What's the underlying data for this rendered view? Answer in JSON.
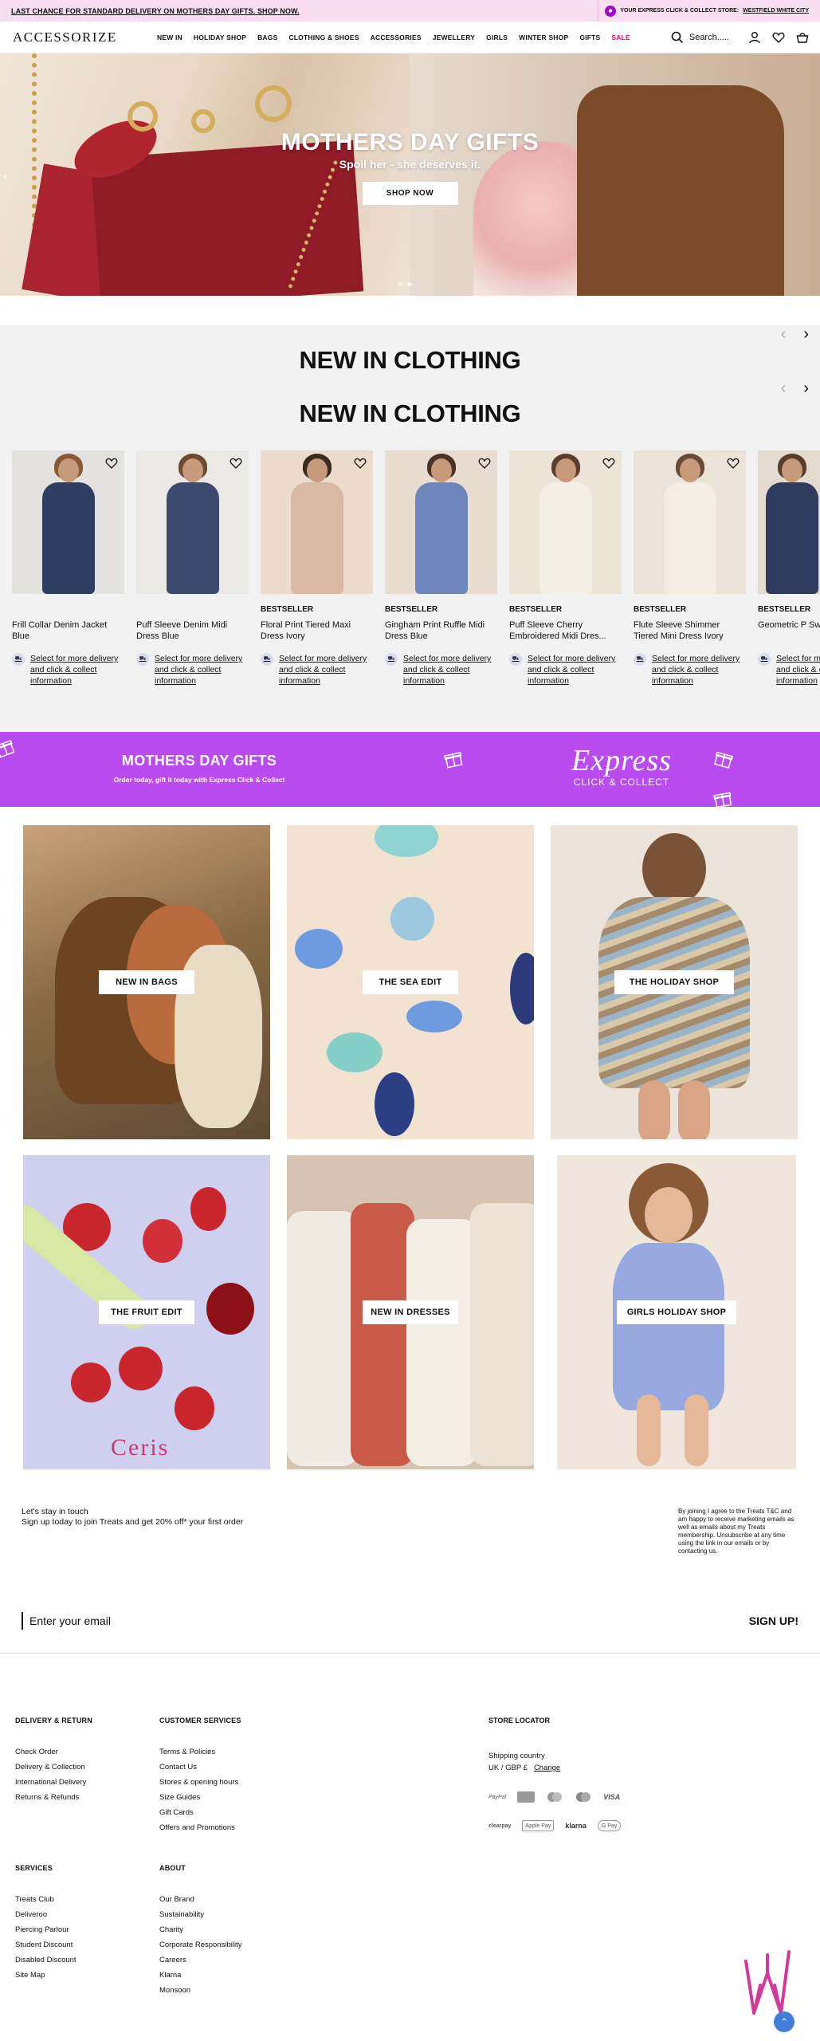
{
  "promo": {
    "left_text": "LAST CHANCE FOR STANDARD DELIVERY ON MOTHERS DAY GIFTS. SHOP NOW.",
    "store_label": "YOUR EXPRESS CLICK & COLLECT STORE:",
    "store_name": "WESTFIELD WHITE CITY"
  },
  "header": {
    "logo": "ACCESSORIZE",
    "nav": [
      "NEW IN",
      "HOLIDAY SHOP",
      "BAGS",
      "CLOTHING & SHOES",
      "ACCESSORIES",
      "JEWELLERY",
      "GIRLS",
      "WINTER SHOP",
      "GIFTS",
      "SALE"
    ],
    "search_placeholder": "Search....."
  },
  "hero": {
    "title": "MOTHERS DAY GIFTS",
    "subtitle": "Spoil her - she deserves it.",
    "button": "SHOP NOW",
    "arrow": "‹"
  },
  "clothing": {
    "title_1": "NEW IN CLOTHING",
    "title_2": "NEW IN CLOTHING",
    "prev_arrow": "‹",
    "next_arrow": "›",
    "delivery_text": "Select for more delivery and click & collect information",
    "products": [
      {
        "badge": "",
        "name": "Frill Collar Denim Jacket Blue"
      },
      {
        "badge": "",
        "name": "Puff Sleeve Denim Midi Dress Blue"
      },
      {
        "badge": "BESTSELLER",
        "name": "Floral Print Tiered Maxi Dress Ivory"
      },
      {
        "badge": "BESTSELLER",
        "name": "Gingham Print Ruffle Midi Dress Blue"
      },
      {
        "badge": "BESTSELLER",
        "name": "Puff Sleeve Cherry Embroidered Midi Dres..."
      },
      {
        "badge": "BESTSELLER",
        "name": "Flute Sleeve Shimmer Tiered Mini Dress Ivory"
      },
      {
        "badge": "BESTSELLER",
        "name": "Geometric P Swimsuit Blu"
      }
    ]
  },
  "express": {
    "title": "MOTHERS DAY GIFTS",
    "subtitle": "Order today, gift it today with Express Click & Collect",
    "brand": "Express",
    "brand_sub": "CLICK & COLLECT"
  },
  "tiles": [
    {
      "label": "NEW IN BAGS"
    },
    {
      "label": "THE SEA EDIT"
    },
    {
      "label": "THE HOLIDAY SHOP"
    },
    {
      "label": "THE FRUIT EDIT"
    },
    {
      "label": "NEW IN DRESSES"
    },
    {
      "label": "GIRLS HOLIDAY SHOP"
    }
  ],
  "fruit_sign": "Ceris",
  "newsletter": {
    "line1": "Let's stay in touch",
    "line2": "Sign up today to join Treats and get 20% off* your first order",
    "legal": "By joining I agree to the Treats T&C and am happy to receive marketing emails as well as emails about my Treats membership. Unsubscribe at any time using the link in our emails or by contacting us.",
    "placeholder": "Enter your email",
    "button": "SIGN UP!"
  },
  "footer": {
    "delivery": {
      "title": "DELIVERY & RETURN",
      "links": [
        "Check Order",
        "Delivery & Collection",
        "International Delivery",
        "Returns & Refunds"
      ]
    },
    "customer": {
      "title": "CUSTOMER SERVICES",
      "links": [
        "Terms & Policies",
        "Contact Us",
        "Stores & opening hours",
        "Size Guides",
        "Gift Cards",
        "Offers and Promotions"
      ]
    },
    "services": {
      "title": "SERVICES",
      "links": [
        "Treats Club",
        "Deliveroo",
        "Piercing Parlour",
        "Student Discount",
        "Disabled Discount",
        "Site Map"
      ]
    },
    "about": {
      "title": "ABOUT",
      "links": [
        "Our Brand",
        "Sustainability",
        "Charity",
        "Corporate Responsibility",
        "Careers",
        "Klarna",
        "Monsoon"
      ]
    },
    "store_locator": "STORE LOCATOR",
    "shipping_label": "Shipping country",
    "shipping_value": "UK / GBP £",
    "change": "Change",
    "payments_row1": [
      "PayPal",
      "Amex",
      "Maestro",
      "Mastercard",
      "VISA"
    ],
    "payments_row2": [
      "clearpay",
      "Apple Pay",
      "klarna",
      "G Pay"
    ]
  },
  "colors": {
    "promo_bg": "#f8dcef",
    "express_bg": "#b94bf1",
    "sale": "#e4007c",
    "panel_bg": "#f2f2f2"
  }
}
